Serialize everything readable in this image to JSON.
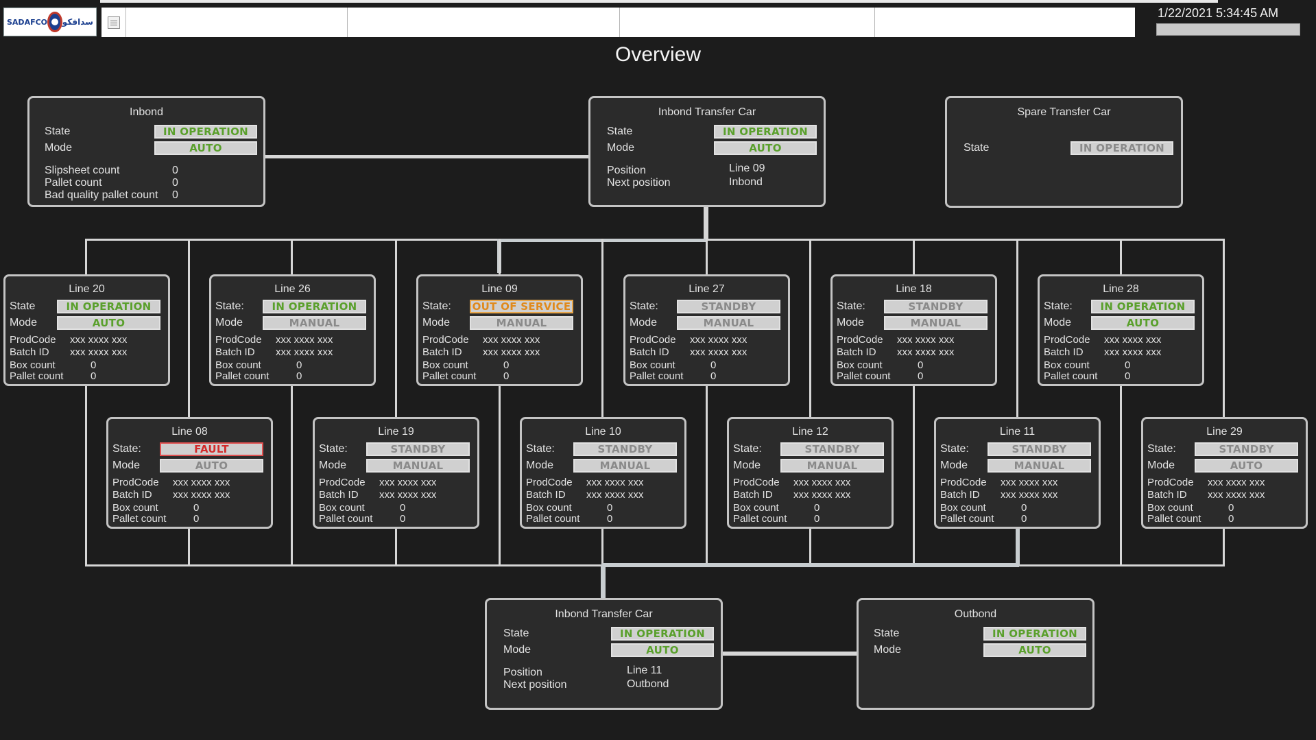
{
  "header": {
    "logo_en": "SADAFCO",
    "logo_ar": "سدافكو",
    "datetime": "1/22/2021 5:34:45 AM"
  },
  "title": "Overview",
  "inbond": {
    "title": "Inbond",
    "state_label": "State",
    "state": "IN OPERATION",
    "mode_label": "Mode",
    "mode": "AUTO",
    "slipsheet_label": "Slipsheet count",
    "slipsheet": "0",
    "pallet_label": "Pallet count",
    "pallet": "0",
    "badq_label": "Bad quality pallet count",
    "badq": "0"
  },
  "inbond_car": {
    "title": "Inbond Transfer Car",
    "state_label": "State",
    "state": "IN OPERATION",
    "mode_label": "Mode",
    "mode": "AUTO",
    "pos_label": "Position",
    "pos": "Line 09",
    "next_label": "Next position",
    "next": "Inbond"
  },
  "spare_car": {
    "title": "Spare Transfer Car",
    "state_label": "State",
    "state": "IN OPERATION"
  },
  "outbond_car": {
    "title": "Inbond Transfer Car",
    "state_label": "State",
    "state": "IN OPERATION",
    "mode_label": "Mode",
    "mode": "AUTO",
    "pos_label": "Position",
    "pos": "Line 11",
    "next_label": "Next position",
    "next": "Outbond"
  },
  "outbond": {
    "title": "Outbond",
    "state_label": "State",
    "state": "IN OPERATION",
    "mode_label": "Mode",
    "mode": "AUTO"
  },
  "labels": {
    "state_colon": "State:",
    "state": "State",
    "mode": "Mode",
    "prodcode": "ProdCode",
    "batch": "Batch ID",
    "box": "Box count",
    "pallet": "Pallet count"
  },
  "lines": [
    {
      "name": "Line 20",
      "state_label": "State",
      "state": "IN OPERATION",
      "state_color": "green",
      "mode": "AUTO",
      "mode_color": "green",
      "prodcode": "xxx xxxx xxx",
      "batch": "xxx xxxx xxx",
      "box": "0",
      "pallet": "0"
    },
    {
      "name": "Line 26",
      "state_label": "State:",
      "state": "IN OPERATION",
      "state_color": "green",
      "mode": "MANUAL",
      "mode_color": "grey",
      "prodcode": "xxx xxxx xxx",
      "batch": "xxx xxxx xxx",
      "box": "0",
      "pallet": "0"
    },
    {
      "name": "Line 09",
      "state_label": "State:",
      "state": "OUT OF SERVICE",
      "state_color": "orange",
      "mode": "MANUAL",
      "mode_color": "grey",
      "prodcode": "xxx xxxx xxx",
      "batch": "xxx xxxx xxx",
      "box": "0",
      "pallet": "0"
    },
    {
      "name": "Line 27",
      "state_label": "State:",
      "state": "STANDBY",
      "state_color": "grey",
      "mode": "MANUAL",
      "mode_color": "grey",
      "prodcode": "xxx xxxx xxx",
      "batch": "xxx xxxx xxx",
      "box": "0",
      "pallet": "0"
    },
    {
      "name": "Line 18",
      "state_label": "State:",
      "state": "STANDBY",
      "state_color": "grey",
      "mode": "MANUAL",
      "mode_color": "grey",
      "prodcode": "xxx xxxx xxx",
      "batch": "xxx xxxx xxx",
      "box": "0",
      "pallet": "0"
    },
    {
      "name": "Line 28",
      "state_label": "State:",
      "state": "IN OPERATION",
      "state_color": "green",
      "mode": "AUTO",
      "mode_color": "green",
      "prodcode": "xxx xxxx xxx",
      "batch": "xxx xxxx xxx",
      "box": "0",
      "pallet": "0"
    },
    {
      "name": "Line 08",
      "state_label": "State:",
      "state": "FAULT",
      "state_color": "red",
      "mode": "AUTO",
      "mode_color": "grey",
      "prodcode": "xxx xxxx xxx",
      "batch": "xxx xxxx xxx",
      "box": "0",
      "pallet": "0"
    },
    {
      "name": "Line 19",
      "state_label": "State:",
      "state": "STANDBY",
      "state_color": "grey",
      "mode": "MANUAL",
      "mode_color": "grey",
      "prodcode": "xxx xxxx xxx",
      "batch": "xxx xxxx xxx",
      "box": "0",
      "pallet": "0"
    },
    {
      "name": "Line 10",
      "state_label": "State:",
      "state": "STANDBY",
      "state_color": "grey",
      "mode": "MANUAL",
      "mode_color": "grey",
      "prodcode": "xxx xxxx xxx",
      "batch": "xxx xxxx xxx",
      "box": "0",
      "pallet": "0"
    },
    {
      "name": "Line 12",
      "state_label": "State:",
      "state": "STANDBY",
      "state_color": "grey",
      "mode": "MANUAL",
      "mode_color": "grey",
      "prodcode": "xxx xxxx xxx",
      "batch": "xxx xxxx xxx",
      "box": "0",
      "pallet": "0"
    },
    {
      "name": "Line 11",
      "state_label": "State:",
      "state": "STANDBY",
      "state_color": "grey",
      "mode": "MANUAL",
      "mode_color": "grey",
      "prodcode": "xxx xxxx xxx",
      "batch": "xxx xxxx xxx",
      "box": "0",
      "pallet": "0"
    },
    {
      "name": "Line 29",
      "state_label": "State:",
      "state": "STANDBY",
      "state_color": "grey",
      "mode": "AUTO",
      "mode_color": "grey",
      "prodcode": "xxx xxxx xxx",
      "batch": "xxx xxxx xxx",
      "box": "0",
      "pallet": "0"
    }
  ]
}
